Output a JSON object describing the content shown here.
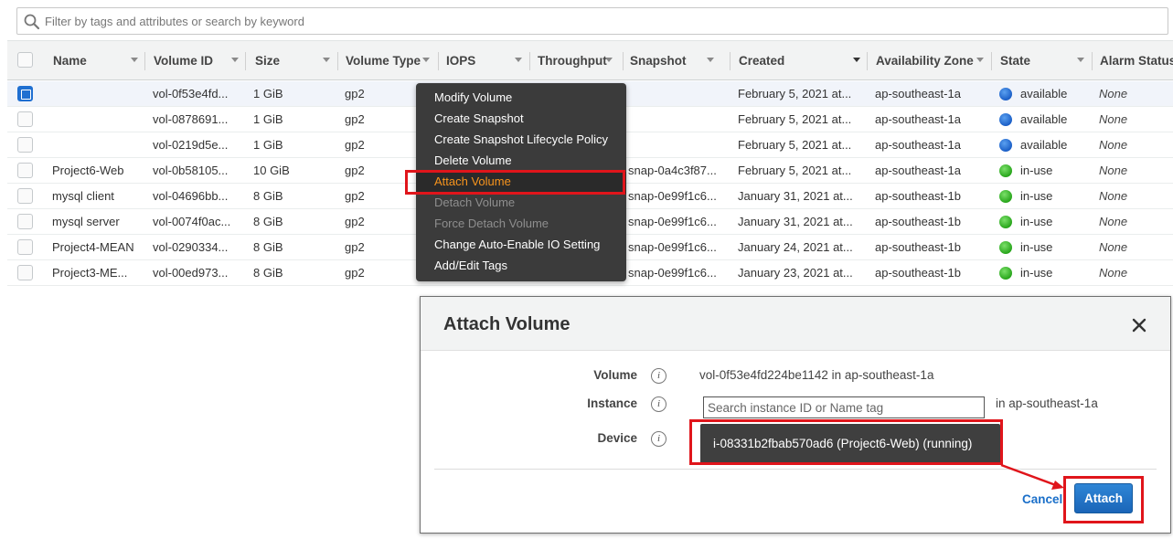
{
  "search": {
    "placeholder": "Filter by tags and attributes or search by keyword"
  },
  "columns": [
    "Name",
    "Volume ID",
    "Size",
    "Volume Type",
    "IOPS",
    "Throughput",
    "Snapshot",
    "Created",
    "Availability Zone",
    "State",
    "Alarm Status"
  ],
  "rows": [
    {
      "name": "",
      "volume_id": "vol-0f53e4fd...",
      "size": "1 GiB",
      "type": "gp2",
      "snapshot": "",
      "created": "February 5, 2021 at...",
      "az": "ap-southeast-1a",
      "state": "available",
      "alarm": "None",
      "selected": true
    },
    {
      "name": "",
      "volume_id": "vol-0878691...",
      "size": "1 GiB",
      "type": "gp2",
      "snapshot": "",
      "created": "February 5, 2021 at...",
      "az": "ap-southeast-1a",
      "state": "available",
      "alarm": "None"
    },
    {
      "name": "",
      "volume_id": "vol-0219d5e...",
      "size": "1 GiB",
      "type": "gp2",
      "snapshot": "",
      "created": "February 5, 2021 at...",
      "az": "ap-southeast-1a",
      "state": "available",
      "alarm": "None"
    },
    {
      "name": "Project6-Web",
      "volume_id": "vol-0b58105...",
      "size": "10 GiB",
      "type": "gp2",
      "snapshot": "snap-0a4c3f87...",
      "created": "February 5, 2021 at...",
      "az": "ap-southeast-1a",
      "state": "in-use",
      "alarm": "None"
    },
    {
      "name": "mysql client",
      "volume_id": "vol-04696bb...",
      "size": "8 GiB",
      "type": "gp2",
      "snapshot": "snap-0e99f1c6...",
      "created": "January 31, 2021 at...",
      "az": "ap-southeast-1b",
      "state": "in-use",
      "alarm": "None"
    },
    {
      "name": "mysql server",
      "volume_id": "vol-0074f0ac...",
      "size": "8 GiB",
      "type": "gp2",
      "snapshot": "snap-0e99f1c6...",
      "created": "January 31, 2021 at...",
      "az": "ap-southeast-1b",
      "state": "in-use",
      "alarm": "None"
    },
    {
      "name": "Project4-MEAN",
      "volume_id": "vol-0290334...",
      "size": "8 GiB",
      "type": "gp2",
      "snapshot": "snap-0e99f1c6...",
      "created": "January 24, 2021 at...",
      "az": "ap-southeast-1b",
      "state": "in-use",
      "alarm": "None"
    },
    {
      "name": "Project3-ME...",
      "volume_id": "vol-00ed973...",
      "size": "8 GiB",
      "type": "gp2",
      "snapshot": "snap-0e99f1c6...",
      "created": "January 23, 2021 at...",
      "az": "ap-southeast-1b",
      "state": "in-use",
      "alarm": "None"
    }
  ],
  "context_menu": [
    {
      "label": "Modify Volume",
      "state": "normal"
    },
    {
      "label": "Create Snapshot",
      "state": "normal"
    },
    {
      "label": "Create Snapshot Lifecycle Policy",
      "state": "normal"
    },
    {
      "label": "Delete Volume",
      "state": "normal"
    },
    {
      "label": "Attach Volume",
      "state": "highlight"
    },
    {
      "label": "Detach Volume",
      "state": "disabled"
    },
    {
      "label": "Force Detach Volume",
      "state": "disabled"
    },
    {
      "label": "Change Auto-Enable IO Setting",
      "state": "normal"
    },
    {
      "label": "Add/Edit Tags",
      "state": "normal"
    }
  ],
  "modal": {
    "title": "Attach Volume",
    "volume_label": "Volume",
    "volume_value": "vol-0f53e4fd224be1142 in ap-southeast-1a",
    "instance_label": "Instance",
    "instance_placeholder": "Search instance ID or Name tag",
    "instance_suffix": "in ap-southeast-1a",
    "device_label": "Device",
    "dropdown_option": "i-08331b2fbab570ad6 (Project6-Web) (running)",
    "cancel_label": "Cancel",
    "attach_label": "Attach",
    "info_glyph": "i"
  },
  "colors": {
    "state_available": "#1b5fc7",
    "state_in_use": "#29a61c",
    "highlight_red": "#e0151b",
    "menu_highlight": "#f7941d",
    "primary_button": "#1a65b8"
  },
  "icons": {
    "search": "search-icon",
    "close": "close-icon",
    "info": "info-icon",
    "sort_caret": "caret-down-icon"
  }
}
